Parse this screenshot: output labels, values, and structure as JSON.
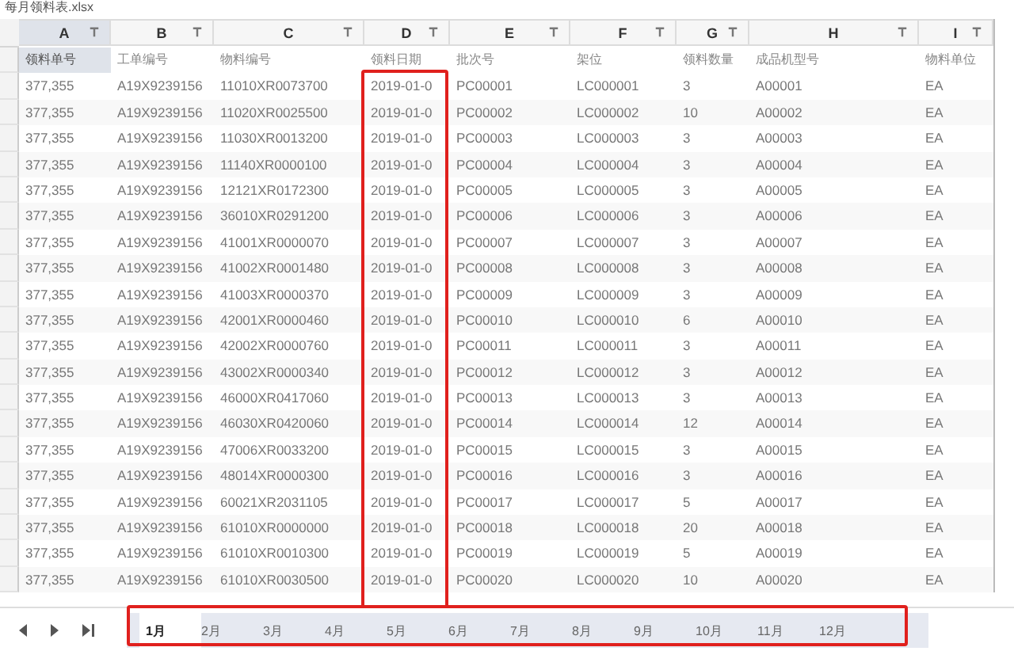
{
  "file_title": "每月领料表.xlsx",
  "columns": [
    {
      "letter": "A",
      "selected": true
    },
    {
      "letter": "B",
      "selected": false
    },
    {
      "letter": "C",
      "selected": false
    },
    {
      "letter": "D",
      "selected": false
    },
    {
      "letter": "E",
      "selected": false
    },
    {
      "letter": "F",
      "selected": false
    },
    {
      "letter": "G",
      "selected": false
    },
    {
      "letter": "H",
      "selected": false
    },
    {
      "letter": "I",
      "selected": false
    }
  ],
  "field_names": [
    "领料单号",
    "工单编号",
    "物料编号",
    "领料日期",
    "批次号",
    "架位",
    "领料数量",
    "成品机型号",
    "物料单位"
  ],
  "rows": [
    [
      "377,355",
      "A19X9239156",
      "11010XR0073700",
      "2019-01-0",
      "PC00001",
      "LC000001",
      "3",
      "A00001",
      "EA"
    ],
    [
      "377,355",
      "A19X9239156",
      "11020XR0025500",
      "2019-01-0",
      "PC00002",
      "LC000002",
      "10",
      "A00002",
      "EA"
    ],
    [
      "377,355",
      "A19X9239156",
      "11030XR0013200",
      "2019-01-0",
      "PC00003",
      "LC000003",
      "3",
      "A00003",
      "EA"
    ],
    [
      "377,355",
      "A19X9239156",
      "11140XR0000100",
      "2019-01-0",
      "PC00004",
      "LC000004",
      "3",
      "A00004",
      "EA"
    ],
    [
      "377,355",
      "A19X9239156",
      "12121XR0172300",
      "2019-01-0",
      "PC00005",
      "LC000005",
      "3",
      "A00005",
      "EA"
    ],
    [
      "377,355",
      "A19X9239156",
      "36010XR0291200",
      "2019-01-0",
      "PC00006",
      "LC000006",
      "3",
      "A00006",
      "EA"
    ],
    [
      "377,355",
      "A19X9239156",
      "41001XR0000070",
      "2019-01-0",
      "PC00007",
      "LC000007",
      "3",
      "A00007",
      "EA"
    ],
    [
      "377,355",
      "A19X9239156",
      "41002XR0001480",
      "2019-01-0",
      "PC00008",
      "LC000008",
      "3",
      "A00008",
      "EA"
    ],
    [
      "377,355",
      "A19X9239156",
      "41003XR0000370",
      "2019-01-0",
      "PC00009",
      "LC000009",
      "3",
      "A00009",
      "EA"
    ],
    [
      "377,355",
      "A19X9239156",
      "42001XR0000460",
      "2019-01-0",
      "PC00010",
      "LC000010",
      "6",
      "A00010",
      "EA"
    ],
    [
      "377,355",
      "A19X9239156",
      "42002XR0000760",
      "2019-01-0",
      "PC00011",
      "LC000011",
      "3",
      "A00011",
      "EA"
    ],
    [
      "377,355",
      "A19X9239156",
      "43002XR0000340",
      "2019-01-0",
      "PC00012",
      "LC000012",
      "3",
      "A00012",
      "EA"
    ],
    [
      "377,355",
      "A19X9239156",
      "46000XR0417060",
      "2019-01-0",
      "PC00013",
      "LC000013",
      "3",
      "A00013",
      "EA"
    ],
    [
      "377,355",
      "A19X9239156",
      "46030XR0420060",
      "2019-01-0",
      "PC00014",
      "LC000014",
      "12",
      "A00014",
      "EA"
    ],
    [
      "377,355",
      "A19X9239156",
      "47006XR0033200",
      "2019-01-0",
      "PC00015",
      "LC000015",
      "3",
      "A00015",
      "EA"
    ],
    [
      "377,355",
      "A19X9239156",
      "48014XR0000300",
      "2019-01-0",
      "PC00016",
      "LC000016",
      "3",
      "A00016",
      "EA"
    ],
    [
      "377,355",
      "A19X9239156",
      "60021XR2031105",
      "2019-01-0",
      "PC00017",
      "LC000017",
      "5",
      "A00017",
      "EA"
    ],
    [
      "377,355",
      "A19X9239156",
      "61010XR0000000",
      "2019-01-0",
      "PC00018",
      "LC000018",
      "20",
      "A00018",
      "EA"
    ],
    [
      "377,355",
      "A19X9239156",
      "61010XR0010300",
      "2019-01-0",
      "PC00019",
      "LC000019",
      "5",
      "A00019",
      "EA"
    ],
    [
      "377,355",
      "A19X9239156",
      "61010XR0030500",
      "2019-01-0",
      "PC00020",
      "LC000020",
      "10",
      "A00020",
      "EA"
    ]
  ],
  "sheet_tabs": [
    {
      "label": "1月",
      "selected": true
    },
    {
      "label": "2月",
      "selected": false
    },
    {
      "label": "3月",
      "selected": false
    },
    {
      "label": "4月",
      "selected": false
    },
    {
      "label": "5月",
      "selected": false
    },
    {
      "label": "6月",
      "selected": false
    },
    {
      "label": "7月",
      "selected": false
    },
    {
      "label": "8月",
      "selected": false
    },
    {
      "label": "9月",
      "selected": false
    },
    {
      "label": "10月",
      "selected": false
    },
    {
      "label": "11月",
      "selected": false
    },
    {
      "label": "12月",
      "selected": false
    }
  ]
}
